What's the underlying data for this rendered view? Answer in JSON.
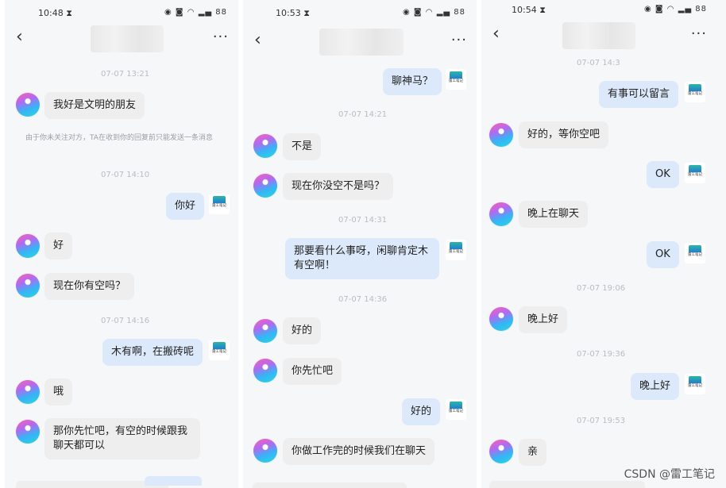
{
  "panels": [
    {
      "status": {
        "time": "10:48 ⧗",
        "icons": "◉ ◙ ◠ ▂▄ 88"
      },
      "timestamps": [
        "07-07 13:21",
        "07-07 14:10",
        "07-07 14:16"
      ],
      "system_note": "由于你未关注对方，TA在收到你的回复前只能发送一条消息",
      "messages": [
        "我好是文明的朋友",
        "你好",
        "好",
        "现在你有空吗？",
        "木有啊，在搬砖呢",
        "哦",
        "那你先忙吧，有空的时候跟我聊天都可以"
      ]
    },
    {
      "status": {
        "time": "10:53 ⧗",
        "icons": "◉ ◙ ◠ ▂▄ 88"
      },
      "timestamps": [
        "07-07 14:21",
        "07-07 14:31",
        "07-07 14:36"
      ],
      "messages": [
        "聊神马？",
        "不是",
        "现在你没空不是吗？",
        "那要看什么事呀，闲聊肯定木有空啊！",
        "好的",
        "你先忙吧",
        "好的",
        "你做工作完的时候我们在聊天"
      ]
    },
    {
      "status": {
        "time": "10:54 ⧗",
        "icons": "◉ ◙ ◠ ▂▄ 88"
      },
      "timestamps": [
        "07-07 14:3",
        "07-07 19:06",
        "07-07 19:36",
        "07-07 19:53"
      ],
      "messages": [
        "有事可以留言",
        "好的，等你空吧",
        "OK",
        "晚上在聊天",
        "OK",
        "晚上好",
        "晚上好",
        "亲"
      ]
    }
  ],
  "logo_text": "雷工笔记",
  "nav": {
    "back": "‹",
    "more": "···"
  },
  "watermark": "CSDN @雷工笔记"
}
